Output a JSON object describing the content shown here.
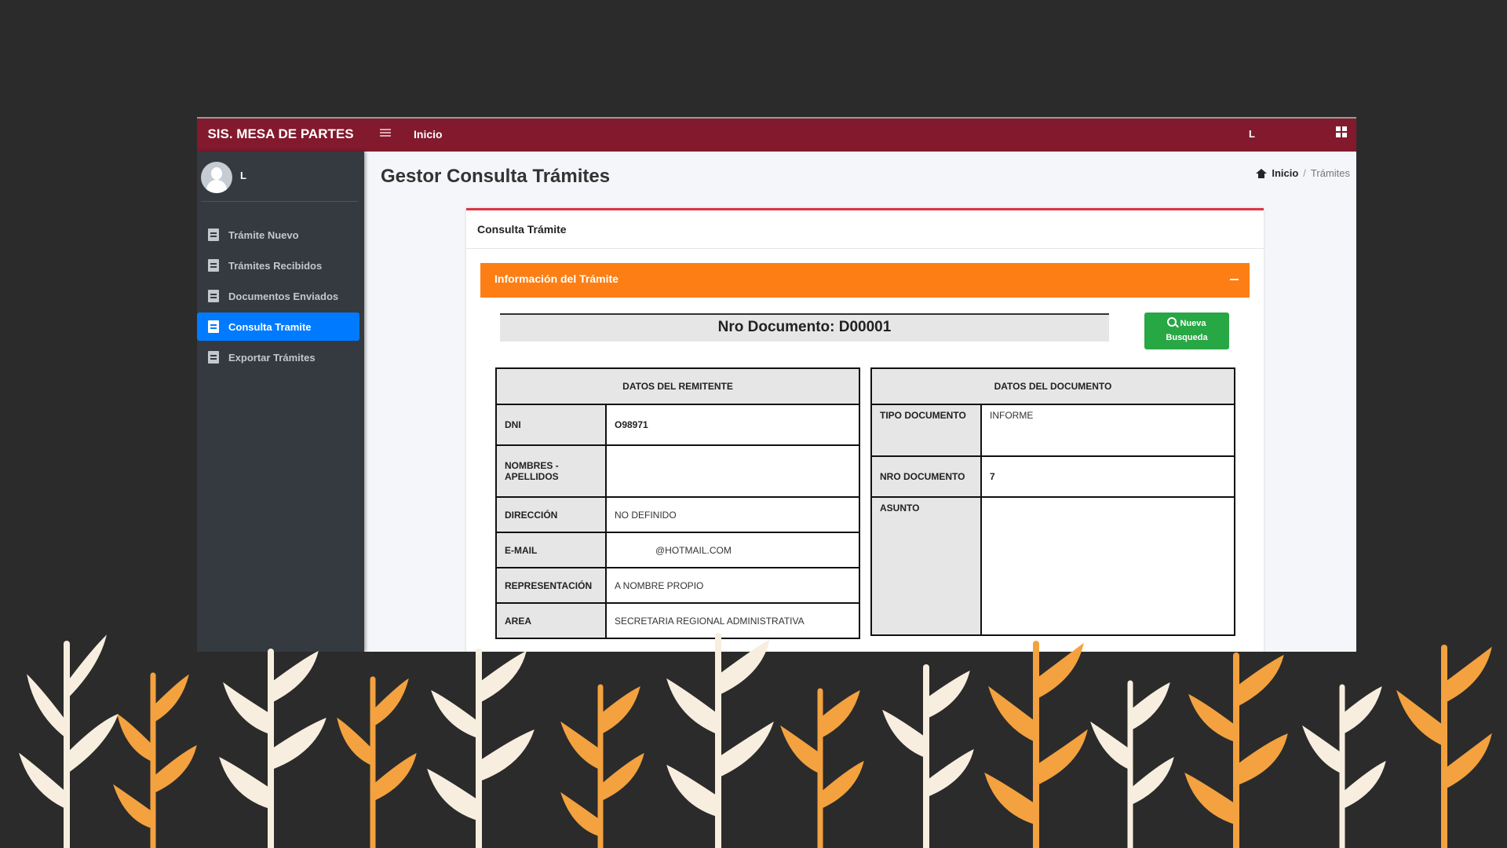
{
  "app": {
    "brand": "SIS. MESA DE PARTES",
    "nav_inicio": "Inicio",
    "top_user": "L"
  },
  "sidebar": {
    "user_name": "L",
    "items": [
      {
        "label": "Trámite Nuevo",
        "icon": "file-plus-icon",
        "active": false
      },
      {
        "label": "Trámites Recibidos",
        "icon": "edit-icon",
        "active": false
      },
      {
        "label": "Documentos Enviados",
        "icon": "edit-icon",
        "active": false
      },
      {
        "label": "Consulta Tramite",
        "icon": "edit-icon",
        "active": true
      },
      {
        "label": "Exportar Trámites",
        "icon": "file-pdf-icon",
        "active": false
      }
    ]
  },
  "page": {
    "title": "Gestor Consulta Trámites",
    "breadcrumb_home": "Inicio",
    "breadcrumb_sep": "/",
    "breadcrumb_current": "Trámites"
  },
  "card": {
    "header": "Consulta Trámite",
    "info_title": "Información del Trámite",
    "doc_number": "Nro Documento: D00001",
    "new_search_line1": "Nueva",
    "new_search_line2": "Busqueda"
  },
  "remitente": {
    "title": "DATOS DEL REMITENTE",
    "rows": [
      {
        "label": "DNI",
        "value": "O98971"
      },
      {
        "label": "NOMBRES - APELLIDOS",
        "value": ""
      },
      {
        "label": "DIRECCIÓN",
        "value": "NO DEFINIDO"
      },
      {
        "label": "E-MAIL",
        "value": "@HOTMAIL.COM"
      },
      {
        "label": "REPRESENTACIÓN",
        "value": "A NOMBRE PROPIO"
      },
      {
        "label": "AREA",
        "value": "SECRETARIA REGIONAL ADMINISTRATIVA"
      }
    ]
  },
  "documento": {
    "title": "DATOS DEL DOCUMENTO",
    "rows": [
      {
        "label": "TIPO DOCUMENTO",
        "value": "INFORME"
      },
      {
        "label": "NRO DOCUMENTO",
        "value": "7"
      },
      {
        "label": "ASUNTO",
        "value": ""
      }
    ]
  },
  "colors": {
    "topbar": "#82192d",
    "sidebar": "#343a40",
    "active_item": "#007bff",
    "info_bar": "#fd7e14",
    "button": "#28a745",
    "page_bg": "#2b2b2b",
    "leaf_cream": "#f7eedf",
    "leaf_orange": "#f3a23f"
  }
}
